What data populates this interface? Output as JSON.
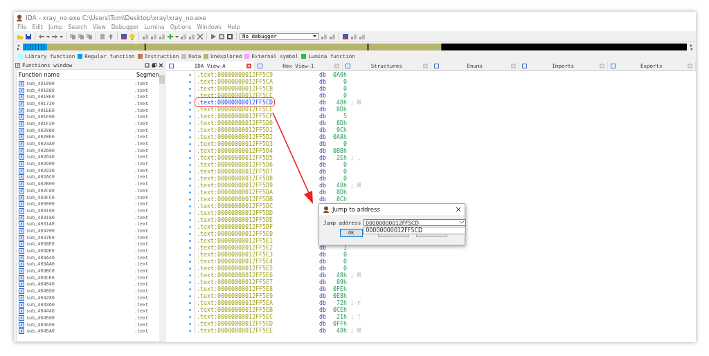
{
  "window": {
    "title": "IDA - xray_no.exe C:\\Users\\Tom\\Desktop\\xray\\xray_no.exe"
  },
  "menu": [
    "File",
    "Edit",
    "Jump",
    "Search",
    "View",
    "Debugger",
    "Lumina",
    "Options",
    "Windows",
    "Help"
  ],
  "toolbar": {
    "debugger_select": "No debugger"
  },
  "legend": [
    {
      "label": "Library function",
      "color": "#a8ffff"
    },
    {
      "label": "Regular function",
      "color": "#00a0e8"
    },
    {
      "label": "Instruction",
      "color": "#c07850"
    },
    {
      "label": "Data",
      "color": "#c0c0c0"
    },
    {
      "label": "Unexplored",
      "color": "#b4b46c"
    },
    {
      "label": "External symbol",
      "color": "#ff9cff"
    },
    {
      "label": "Lumina function",
      "color": "#30c030"
    }
  ],
  "functions_window": {
    "title": "Functions window",
    "columns": [
      "Function name",
      "Segmen"
    ],
    "rows": [
      {
        "name": "sub_401000",
        "segment": ".text"
      },
      {
        "name": "sub_401080",
        "segment": ".text"
      },
      {
        "name": "sub_4010E0",
        "segment": ".text"
      },
      {
        "name": "sub_401720",
        "segment": ".text"
      },
      {
        "name": "sub_401EE0",
        "segment": ".text"
      },
      {
        "name": "sub_401F00",
        "segment": ".text"
      },
      {
        "name": "sub_401F20",
        "segment": ".text"
      },
      {
        "name": "sub_402060",
        "segment": ".text"
      },
      {
        "name": "sub_4020E0",
        "segment": ".text"
      },
      {
        "name": "sub_4023A0",
        "segment": ".text"
      },
      {
        "name": "sub_402600",
        "segment": ".text"
      },
      {
        "name": "sub_402640",
        "segment": ".text"
      },
      {
        "name": "sub_402900",
        "segment": ".text"
      },
      {
        "name": "sub_402920",
        "segment": ".text"
      },
      {
        "name": "sub_402AC0",
        "segment": ".text"
      },
      {
        "name": "sub_402B00",
        "segment": ".text"
      },
      {
        "name": "sub_402C80",
        "segment": ".text"
      },
      {
        "name": "sub_402FC0",
        "segment": ".text"
      },
      {
        "name": "sub_403000",
        "segment": ".text"
      },
      {
        "name": "sub_403160",
        "segment": ".text"
      },
      {
        "name": "sub_403180",
        "segment": ".text"
      },
      {
        "name": "sub_4031A0",
        "segment": ".text"
      },
      {
        "name": "sub_403200",
        "segment": ".text"
      },
      {
        "name": "sub_4037E0",
        "segment": ".text"
      },
      {
        "name": "sub_4038E0",
        "segment": ".text"
      },
      {
        "name": "sub_4039E0",
        "segment": ".text"
      },
      {
        "name": "sub_403A40",
        "segment": ".text"
      },
      {
        "name": "sub_403AA0",
        "segment": ".text"
      },
      {
        "name": "sub_403BC0",
        "segment": ".text"
      },
      {
        "name": "sub_403CE0",
        "segment": ".text"
      },
      {
        "name": "sub_404040",
        "segment": ".text"
      },
      {
        "name": "sub_404080",
        "segment": ".text"
      },
      {
        "name": "sub_404280",
        "segment": ".text"
      },
      {
        "name": "sub_404360",
        "segment": ".text"
      },
      {
        "name": "sub_404440",
        "segment": ".text"
      },
      {
        "name": "sub_404500",
        "segment": ".text"
      },
      {
        "name": "sub_404560",
        "segment": ".text"
      },
      {
        "name": "sub_4045A0",
        "segment": ".text"
      }
    ]
  },
  "tabs": [
    {
      "label": "IDA View-A",
      "selected": true
    },
    {
      "label": "Hex View-1",
      "selected": false
    },
    {
      "label": "Structures",
      "selected": false
    },
    {
      "label": "Enums",
      "selected": false
    },
    {
      "label": "Imports",
      "selected": false
    },
    {
      "label": "Exports",
      "selected": false
    }
  ],
  "disassembly": [
    {
      "address": ".text:00000000012FF5C9",
      "mnemonic": "db",
      "value": "0A0h",
      "highlighted": false
    },
    {
      "address": ".text:00000000012FF5CA",
      "mnemonic": "db",
      "value": "0",
      "highlighted": false
    },
    {
      "address": ".text:00000000012FF5CB",
      "mnemonic": "db",
      "value": "0",
      "highlighted": false
    },
    {
      "address": ".text:00000000012FF5CC",
      "mnemonic": "db",
      "value": "0",
      "highlighted": false
    },
    {
      "address": ".text:00000000012FF5CD",
      "mnemonic": "db",
      "value": "48h",
      "comment": "; H",
      "highlighted": true
    },
    {
      "address": ".text:00000000012FF5CE",
      "mnemonic": "db",
      "value": "8Dh",
      "highlighted": false
    },
    {
      "address": ".text:00000000012FF5CF",
      "mnemonic": "db",
      "value": "5",
      "highlighted": false
    },
    {
      "address": ".text:00000000012FF5D0",
      "mnemonic": "db",
      "value": "8Dh",
      "highlighted": false
    },
    {
      "address": ".text:00000000012FF5D1",
      "mnemonic": "db",
      "value": "9Ch",
      "highlighted": false
    },
    {
      "address": ".text:00000000012FF5D2",
      "mnemonic": "db",
      "value": "0A8h",
      "highlighted": false
    },
    {
      "address": ".text:00000000012FF5D3",
      "mnemonic": "db",
      "value": "0",
      "highlighted": false
    },
    {
      "address": ".text:00000000012FF5D4",
      "mnemonic": "db",
      "value": "0BBh",
      "highlighted": false
    },
    {
      "address": ".text:00000000012FF5D5",
      "mnemonic": "db",
      "value": "2Eh",
      "comment": "; .",
      "highlighted": false
    },
    {
      "address": ".text:00000000012FF5D6",
      "mnemonic": "db",
      "value": "0",
      "highlighted": false
    },
    {
      "address": ".text:00000000012FF5D7",
      "mnemonic": "db",
      "value": "0",
      "highlighted": false
    },
    {
      "address": ".text:00000000012FF5D8",
      "mnemonic": "db",
      "value": "0",
      "highlighted": false
    },
    {
      "address": ".text:00000000012FF5D9",
      "mnemonic": "db",
      "value": "48h",
      "comment": "; H",
      "highlighted": false
    },
    {
      "address": ".text:00000000012FF5DA",
      "mnemonic": "db",
      "value": "8Dh",
      "highlighted": false
    },
    {
      "address": ".text:00000000012FF5DB",
      "mnemonic": "db",
      "value": "8Ch",
      "highlighted": false
    },
    {
      "address": ".text:00000000012FF5DC",
      "highlighted": false
    },
    {
      "address": ".text:00000000012FF5DD",
      "highlighted": false
    },
    {
      "address": ".text:00000000012FF5DE",
      "highlighted": false
    },
    {
      "address": ".text:00000000012FF5DF",
      "highlighted": false
    },
    {
      "address": ".text:00000000012FF5E0",
      "highlighted": false
    },
    {
      "address": ".text:00000000012FF5E1",
      "highlighted": false
    },
    {
      "address": ".text:00000000012FF5E2",
      "mnemonic": "db",
      "value": "1",
      "highlighted": false
    },
    {
      "address": ".text:00000000012FF5E3",
      "mnemonic": "db",
      "value": "0",
      "highlighted": false
    },
    {
      "address": ".text:00000000012FF5E4",
      "mnemonic": "db",
      "value": "0",
      "highlighted": false
    },
    {
      "address": ".text:00000000012FF5E5",
      "mnemonic": "db",
      "value": "0",
      "highlighted": false
    },
    {
      "address": ".text:00000000012FF5E6",
      "mnemonic": "db",
      "value": "48h",
      "comment": "; H",
      "highlighted": false
    },
    {
      "address": ".text:00000000012FF5E7",
      "mnemonic": "db",
      "value": "89h",
      "highlighted": false
    },
    {
      "address": ".text:00000000012FF5E8",
      "mnemonic": "db",
      "value": "0FEh",
      "highlighted": false
    },
    {
      "address": ".text:00000000012FF5E9",
      "mnemonic": "db",
      "value": "0E8h",
      "highlighted": false
    },
    {
      "address": ".text:00000000012FF5EA",
      "mnemonic": "db",
      "value": "72h",
      "comment": "; r",
      "highlighted": false
    },
    {
      "address": ".text:00000000012FF5EB",
      "mnemonic": "db",
      "value": "0CEh",
      "highlighted": false
    },
    {
      "address": ".text:00000000012FF5EC",
      "mnemonic": "db",
      "value": "21h",
      "comment": "; !",
      "highlighted": false
    },
    {
      "address": ".text:00000000012FF5ED",
      "mnemonic": "db",
      "value": "0FFh",
      "highlighted": false
    },
    {
      "address": ".text:00000000012FF5EE",
      "mnemonic": "db",
      "value": "48h",
      "comment": "; H",
      "highlighted": false
    }
  ],
  "dialog": {
    "title": "Jump to address",
    "label": "Jump address",
    "value": "00000000012FF5CD",
    "suggestions": [
      "00000000012FF5CD"
    ],
    "default_button": "OK"
  }
}
